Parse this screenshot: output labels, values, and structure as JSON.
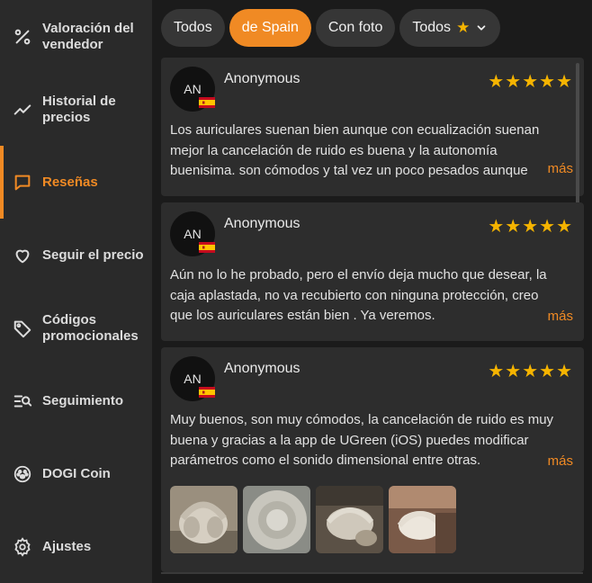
{
  "sidebar": {
    "items": [
      {
        "label": "Valoración del vendedor",
        "icon": "percent-icon",
        "active": false
      },
      {
        "label": "Historial de precios",
        "icon": "trend-line-icon",
        "active": false
      },
      {
        "label": "Reseñas",
        "icon": "chat-bubble-icon",
        "active": true
      },
      {
        "label": "Seguir el precio",
        "icon": "heart-icon",
        "active": false
      },
      {
        "label": "Códigos promocionales",
        "icon": "tag-icon",
        "active": false
      },
      {
        "label": "Seguimiento",
        "icon": "list-search-icon",
        "active": false
      },
      {
        "label": "DOGI Coin",
        "icon": "paw-icon",
        "active": false
      },
      {
        "label": "Ajustes",
        "icon": "gear-icon",
        "active": false
      }
    ]
  },
  "filters": {
    "all": "Todos",
    "spain": "de Spain",
    "photo": "Con foto",
    "rating": "Todos"
  },
  "reviews": [
    {
      "initials": "AN",
      "name": "Anonymous",
      "rating": 5,
      "stars": "★★★★★",
      "text": "Los auriculares suenan bien aunque con ecualización suenan mejor la cancelación de ruido es buena y la autonomía buenisima. son cómodos y tal vez un poco pesados aunque",
      "more": "más"
    },
    {
      "initials": "AN",
      "name": "Anonymous",
      "rating": 5,
      "stars": "★★★★★",
      "text": "Aún no lo he probado, pero el envío deja mucho que desear, la caja aplastada, no va recubierto con ninguna protección, creo que los auriculares están bien . Ya veremos.",
      "more": "más"
    },
    {
      "initials": "AN",
      "name": "Anonymous",
      "rating": 5,
      "stars": "★★★★★",
      "text": "Muy buenos, son muy cómodos, la cancelación de ruido es muy buena y gracias a la app de UGreen (iOS) puedes modificar parámetros como el sonido dimensional entre otras.",
      "more": "más"
    }
  ],
  "colors": {
    "accent": "#f08a24",
    "star": "#f5b400",
    "sidebar_bg": "#2a2a2a",
    "card_bg": "#2d2d2d"
  }
}
